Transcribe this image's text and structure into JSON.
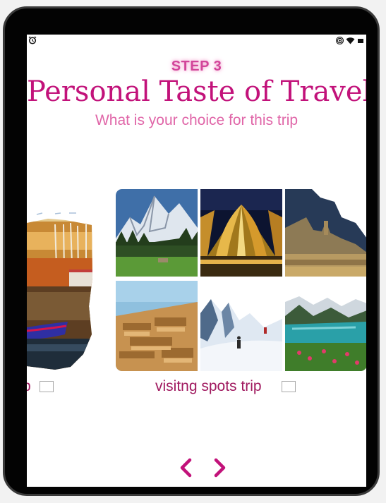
{
  "header": {
    "step": "STEP 3",
    "title": "Personal Taste of Travel",
    "subtitle": "What is your choice for this trip"
  },
  "options": [
    {
      "label_fragment": "p",
      "checked": false
    },
    {
      "label": "visitng spots trip",
      "checked": false
    }
  ],
  "nav": {
    "prev_icon": "chevron-left-icon",
    "next_icon": "chevron-right-icon"
  },
  "colors": {
    "accent": "#c2127a",
    "device": "#030303"
  }
}
